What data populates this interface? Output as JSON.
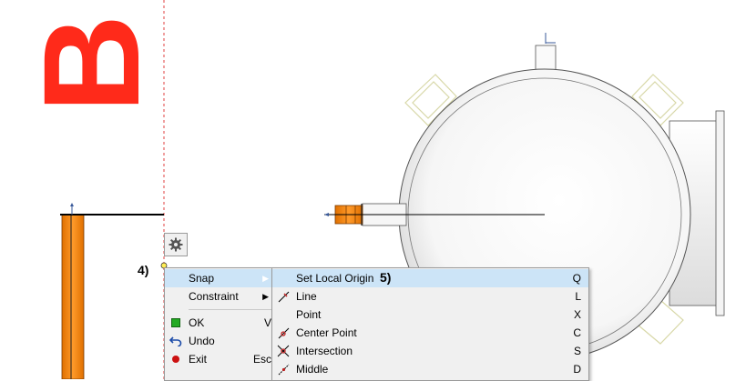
{
  "annotations": {
    "letter": "B",
    "step4": "4)",
    "step5": "5)"
  },
  "gear_button": {
    "icon": "gear-icon"
  },
  "context_menu": {
    "items": [
      {
        "label": "Snap",
        "shortcut": "",
        "icon": "",
        "submenu": true,
        "highlighted": true
      },
      {
        "label": "Constraint",
        "shortcut": "",
        "icon": "",
        "submenu": true,
        "highlighted": false
      },
      {
        "label": "OK",
        "shortcut": "V",
        "icon": "green-square-icon",
        "submenu": false
      },
      {
        "label": "Undo",
        "shortcut": "",
        "icon": "undo-icon",
        "submenu": false
      },
      {
        "label": "Exit",
        "shortcut": "Esc",
        "icon": "red-dot-icon",
        "submenu": false
      }
    ]
  },
  "snap_menu": {
    "items": [
      {
        "label": "Set Local Origin",
        "shortcut": "Q",
        "icon": "",
        "highlighted": true
      },
      {
        "label": "Line",
        "shortcut": "L",
        "icon": "line-snap-icon"
      },
      {
        "label": "Point",
        "shortcut": "X",
        "icon": ""
      },
      {
        "label": "Center Point",
        "shortcut": "C",
        "icon": "center-point-icon"
      },
      {
        "label": "Intersection",
        "shortcut": "S",
        "icon": "intersection-icon"
      },
      {
        "label": "Middle",
        "shortcut": "D",
        "icon": "middle-icon"
      }
    ]
  },
  "colors": {
    "accent_red": "#ff2a1a",
    "pipe_orange": "#ff8a10",
    "highlight": "#cce4f7",
    "menu_bg": "#f0f0f0"
  }
}
